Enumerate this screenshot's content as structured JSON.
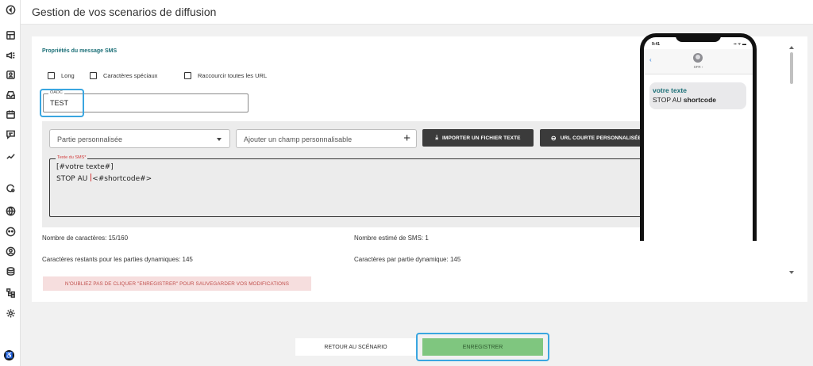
{
  "header": {
    "title": "Gestion de vos scenarios de diffusion"
  },
  "section": {
    "title": "Propriétés du message SMS"
  },
  "options": [
    {
      "label": "Long",
      "checked": false
    },
    {
      "label": "Caractères spéciaux",
      "checked": false
    },
    {
      "label": "Raccourcir toutes les URL",
      "checked": false
    }
  ],
  "oadc": {
    "label": "OADC",
    "value": "TEST"
  },
  "toolbar": {
    "select_placeholder": "Partie personnalisée",
    "add_field_placeholder": "Ajouter un champ personnalisable",
    "import_label": "IMPORTER UN FICHIER TEXTE",
    "short_url_label": "URL COURTE PERSONNALISÉE"
  },
  "sms": {
    "label": "Texte du SMS*",
    "line1": "[#votre texte#]",
    "line2_before": "STOP AU ",
    "line2_after": "<#shortcode#>"
  },
  "stats": {
    "char_count": "Nombre de caractères: 15/160",
    "sms_estimate": "Nombre estimé de SMS: 1",
    "remaining": "Caractères restants pour les parties dynamiques: 145",
    "per_part": "Caractères par partie dynamique: 145"
  },
  "notice": "N'OUBLIEZ PAS DE CLIQUER \"ENREGISTRER\" POUR SAUVEGARDER VOS MODIFICATIONS",
  "phone": {
    "time": "9:41",
    "status": "▪▪ ᯤ ▬",
    "sender": "SFR ›",
    "bubble_highlight": "votre texte",
    "bubble_prefix": "STOP AU ",
    "bubble_bold": "shortcode"
  },
  "footer": {
    "back_label": "RETOUR AU SCÉNARIO",
    "save_label": "ENREGISTRER"
  },
  "colors": {
    "accent": "#1b6f77",
    "focus": "#3aa6e0",
    "save": "#7fc67f",
    "notice_bg": "#f6dede"
  }
}
